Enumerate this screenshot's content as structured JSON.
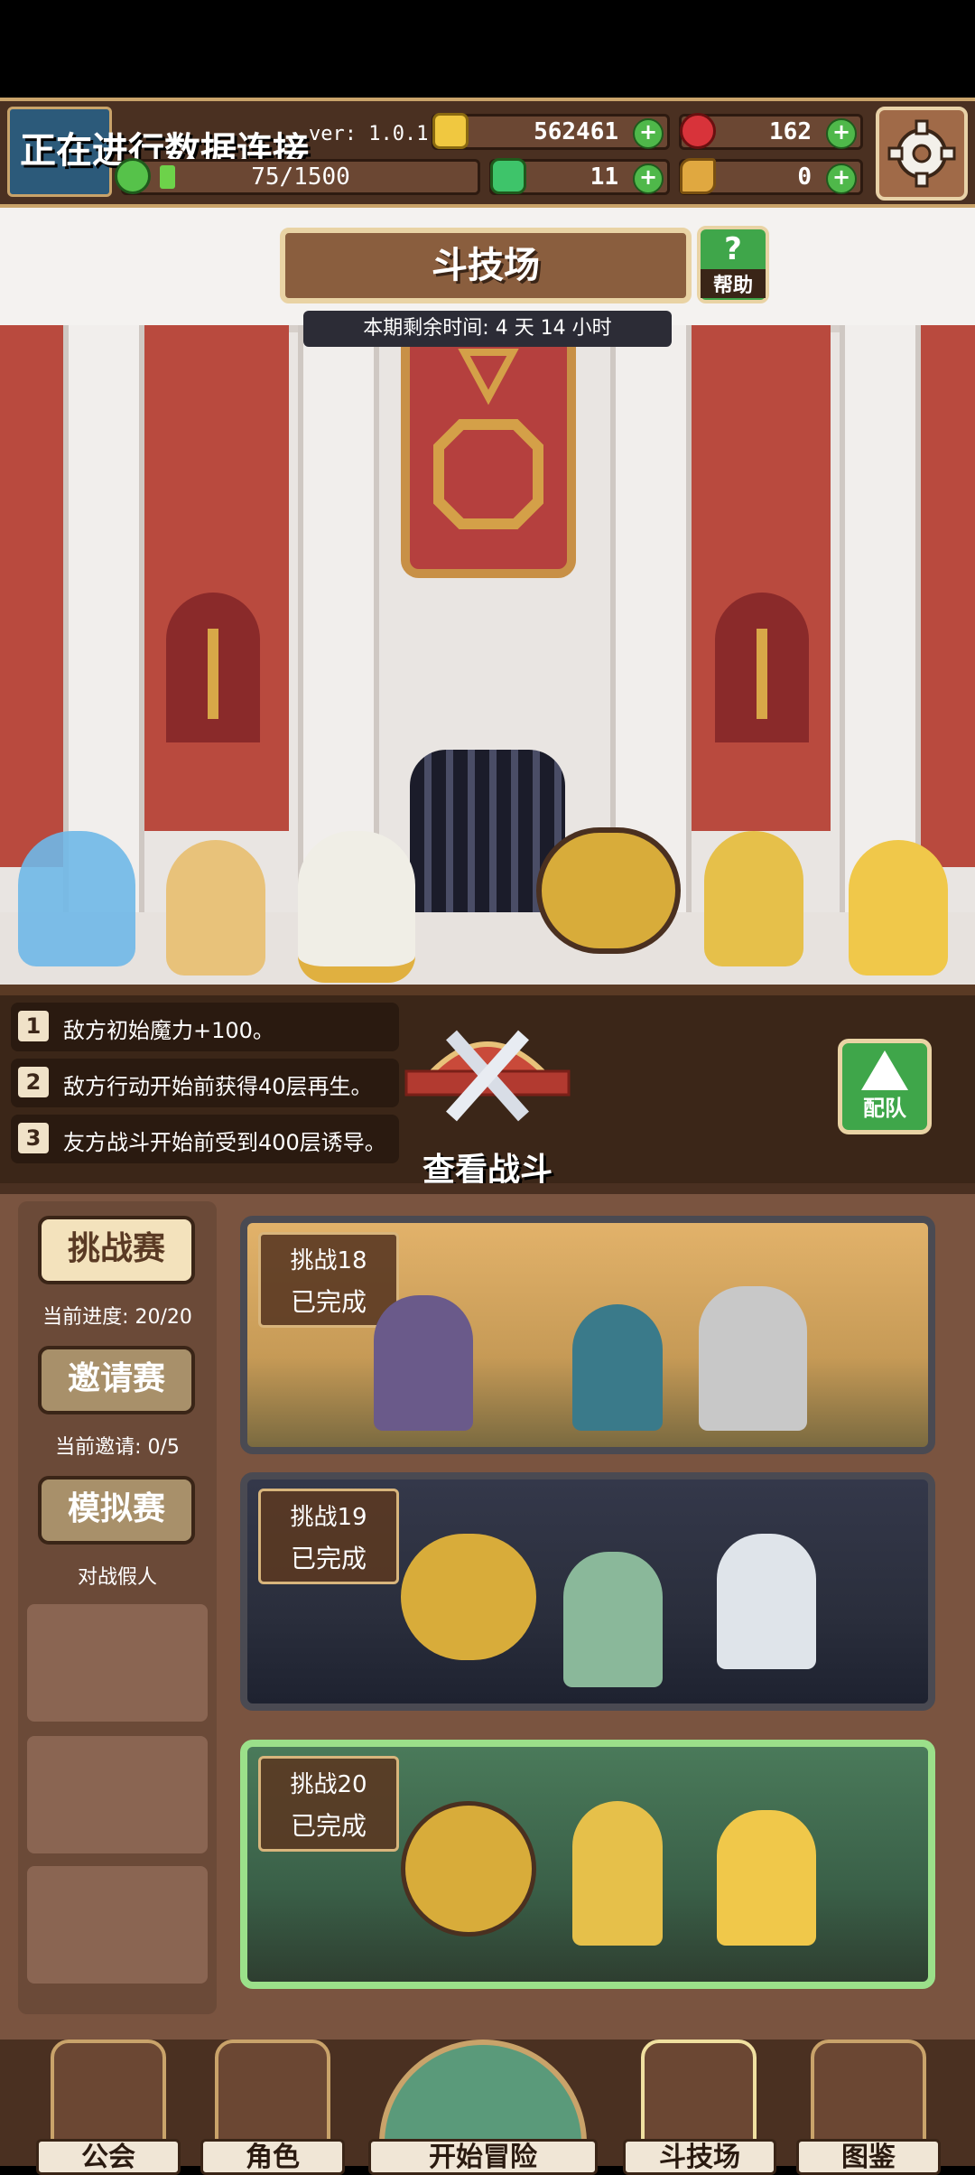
{
  "header": {
    "banner_text": "正在进行数据连接",
    "version": "ver: 1.0.1.0",
    "gold": "562461",
    "ruby": "162",
    "stamina": "75/1500",
    "clover": "11",
    "key": "0",
    "stamina_fill": 0.05
  },
  "arena": {
    "title": "斗技场",
    "help_label": "帮助",
    "timer_text": "本期剩余时间: 4 天 14 小时"
  },
  "rules": [
    {
      "num": "1",
      "text": "敌方初始魔力+100。"
    },
    {
      "num": "2",
      "text": "敌方行动开始前获得40层再生。"
    },
    {
      "num": "3",
      "text": "友方战斗开始前受到400层诱导。"
    }
  ],
  "view_battle_label": "查看战斗",
  "team_label": "配队",
  "modes": [
    {
      "label": "挑战赛",
      "sub": "当前进度: 20/20",
      "active": true
    },
    {
      "label": "邀请赛",
      "sub": "当前邀请: 0/5",
      "active": false
    },
    {
      "label": "模拟赛",
      "sub": "对战假人",
      "active": false
    }
  ],
  "challenges": [
    {
      "title": "挑战18",
      "status": "已完成",
      "selected": false
    },
    {
      "title": "挑战19",
      "status": "已完成",
      "selected": false
    },
    {
      "title": "挑战20",
      "status": "已完成",
      "selected": true
    }
  ],
  "nav": [
    {
      "label": "公会",
      "icon": "guild-icon"
    },
    {
      "label": "角色",
      "icon": "character-icon"
    },
    {
      "label": "开始冒险",
      "icon": "adventure-icon"
    },
    {
      "label": "斗技场",
      "icon": "arena-icon"
    },
    {
      "label": "图鉴",
      "icon": "codex-icon"
    }
  ],
  "colors": {
    "accent_gold": "#d8b57c",
    "plus_green": "#4fb84a",
    "selected_card": "#9be08a"
  }
}
